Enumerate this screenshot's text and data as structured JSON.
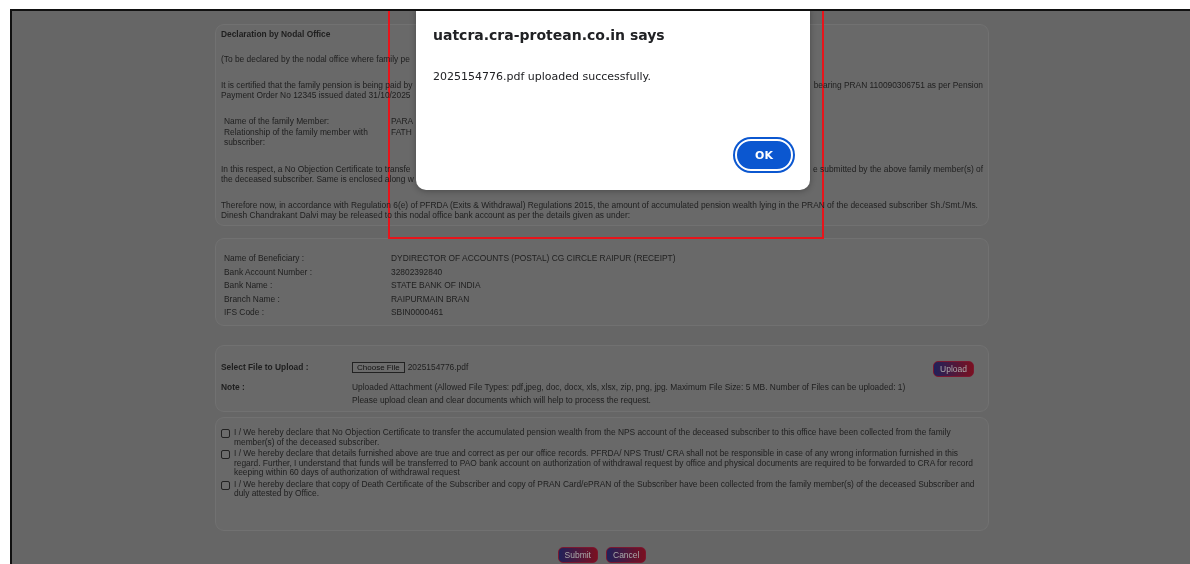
{
  "declaration": {
    "heading": "Declaration by Nodal Office",
    "blocks": [
      {
        "kind": "cut",
        "lines": [
          {
            "left": "(To be declared by the nodal office where family pe"
          }
        ]
      },
      {
        "kind": "cut",
        "lines": [
          {
            "left": "It is certified that the family pension is being paid by",
            "right": "bearing PRAN 110090306751 as per Pension"
          },
          {
            "left": "Payment Order No 12345 issued dated 31/10/2025"
          }
        ]
      },
      {
        "kind": "fields",
        "rows": [
          {
            "label": "Name of the family Member:",
            "value": "PARA"
          },
          {
            "label": "Relationship of the family member with subscriber:",
            "value": "FATH"
          }
        ]
      },
      {
        "kind": "cut",
        "lines": [
          {
            "left": "In this respect, a No Objection Certificate to transfe",
            "right": "e submitted by the above family member(s) of"
          },
          {
            "left": "the deceased subscriber. Same is enclosed along w"
          }
        ]
      },
      {
        "kind": "text",
        "text": "Therefore now, in accordance with Regulation 6(e) of PFRDA (Exits & Withdrawal) Regulations 2015, the amount of accumulated pension wealth lying in the PRAN of the deceased subscriber Sh./Smt./Ms. Dinesh Chandrakant Dalvi may be released to this nodal office bank account as per the details given as under:"
      }
    ]
  },
  "beneficiary": [
    {
      "label": "Name of Beneficiary :",
      "value": "DYDIRECTOR OF ACCOUNTS (POSTAL) CG CIRCLE RAIPUR (RECEIPT)"
    },
    {
      "label": "Bank Account Number :",
      "value": "32802392840"
    },
    {
      "label": "Bank Name :",
      "value": "STATE BANK OF INDIA"
    },
    {
      "label": "Branch Name :",
      "value": "RAIPURMAIN BRAN"
    },
    {
      "label": "IFS Code :",
      "value": "SBIN0000461"
    }
  ],
  "upload": {
    "label": "Select File to Upload :",
    "choose_button": "Choose File",
    "file_name": "2025154776.pdf",
    "upload_button": "Upload",
    "note_label": "Note :",
    "note_lines": [
      "Uploaded Attachment (Allowed File Types: pdf,jpeg, doc, docx, xls, xlsx, zip, png, jpg. Maximum File Size: 5 MB. Number of Files can be uploaded: 1)",
      "Please upload clean and clear documents which will help to process the request."
    ]
  },
  "declarations": [
    {
      "checked": false,
      "text": "I / We hereby declare that No Objection Certificate to transfer the accumulated pension wealth from the NPS account of the deceased subscriber to this office have been collected from the family member(s) of the deceased subscriber."
    },
    {
      "checked": false,
      "text": "I / We hereby declare that details furnished above are true and correct as per our office records. PFRDA/ NPS Trust/ CRA shall not be responsible in case of any wrong information furnished in this regard. Further, I understand that funds will be transferred to PAO bank account on authorization of withdrawal request by office and physical documents are required to be forwarded to CRA for record keeping within 60 days of authorization of withdrawal request"
    },
    {
      "checked": false,
      "text": "I / We hereby declare that copy of Death Certificate of the Subscriber and copy of PRAN Card/ePRAN of the Subscriber have been collected from the family member(s) of the deceased Subscriber and duly attested by Office."
    }
  ],
  "actions": [
    "Submit",
    "Cancel"
  ],
  "dialog": {
    "title": "uatcra.cra-protean.co.in says",
    "message": "2025154776.pdf uploaded successfully.",
    "button": "OK"
  }
}
